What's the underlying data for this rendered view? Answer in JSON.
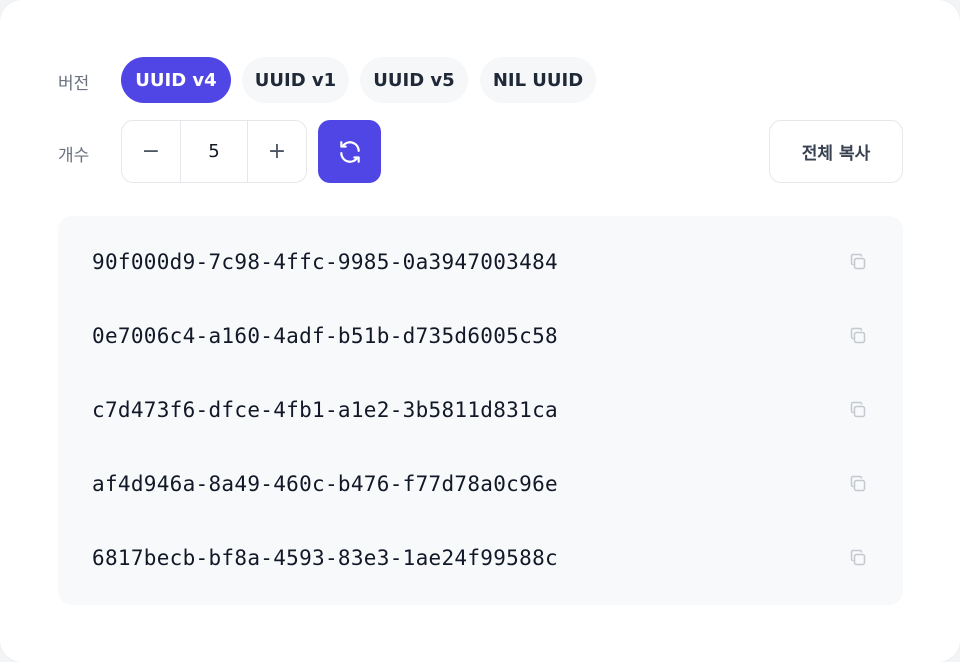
{
  "version": {
    "label": "버전",
    "options": [
      "UUID v4",
      "UUID v1",
      "UUID v5",
      "NIL UUID"
    ],
    "selected": "UUID v4"
  },
  "count": {
    "label": "개수",
    "minus": "−",
    "value": "5",
    "plus": "+"
  },
  "actions": {
    "refresh_icon": "refresh-icon",
    "copy_all_label": "전체 복사"
  },
  "uuids": [
    "90f000d9-7c98-4ffc-9985-0a3947003484",
    "0e7006c4-a160-4adf-b51b-d735d6005c58",
    "c7d473f6-dfce-4fb1-a1e2-3b5811d831ca",
    "af4d946a-8a49-460c-b476-f77d78a0c96e",
    "6817becb-bf8a-4593-83e3-1ae24f99588c"
  ],
  "colors": {
    "accent": "#4f46e5",
    "pill_bg": "#f6f7f9",
    "list_bg": "#f8f9fb"
  }
}
